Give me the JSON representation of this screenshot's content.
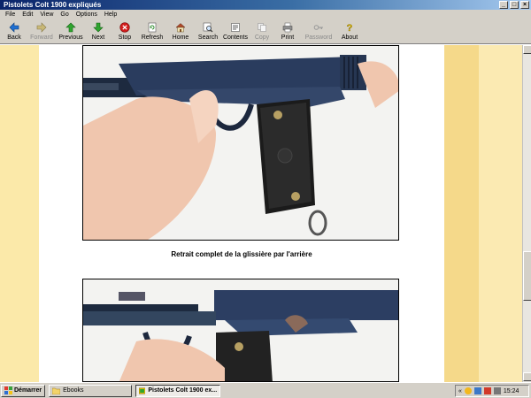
{
  "window": {
    "title": "Pistolets Colt 1900 expliqués",
    "controls": {
      "minimize": "_",
      "maximize": "□",
      "close": "×"
    }
  },
  "menu": {
    "items": [
      {
        "label": "File"
      },
      {
        "label": "Edit"
      },
      {
        "label": "View"
      },
      {
        "label": "Go"
      },
      {
        "label": "Options"
      },
      {
        "label": "Help"
      }
    ]
  },
  "toolbar": {
    "buttons": [
      {
        "label": "Back",
        "icon": "back-arrow-icon",
        "enabled": true
      },
      {
        "label": "Forward",
        "icon": "forward-arrow-icon",
        "enabled": false
      },
      {
        "label": "Previous",
        "icon": "up-arrow-icon",
        "enabled": true
      },
      {
        "label": "Next",
        "icon": "down-arrow-icon",
        "enabled": true
      },
      {
        "label": "Stop",
        "icon": "stop-icon",
        "enabled": true
      },
      {
        "label": "Refresh",
        "icon": "refresh-icon",
        "enabled": true
      },
      {
        "label": "Home",
        "icon": "home-icon",
        "enabled": true
      },
      {
        "label": "Search",
        "icon": "search-icon",
        "enabled": true
      },
      {
        "label": "Contents",
        "icon": "contents-icon",
        "enabled": true
      },
      {
        "label": "Copy",
        "icon": "copy-icon",
        "enabled": false
      },
      {
        "label": "Print",
        "icon": "print-icon",
        "enabled": true
      },
      {
        "label": "Password",
        "icon": "key-icon",
        "enabled": false
      },
      {
        "label": "About",
        "icon": "about-icon",
        "enabled": true
      }
    ]
  },
  "content": {
    "caption": "Retrait complet de la glissière par l'arrière",
    "colors": {
      "band_left": "#fbe9a9",
      "band_right_dark": "#f5d98a",
      "band_right_light": "#fbeab2",
      "page": "#ffffff"
    }
  },
  "taskbar": {
    "start_label": "Démarrer",
    "tasks": [
      {
        "label": "Ebooks"
      },
      {
        "label": "Pistolets Colt 1900 ex..."
      }
    ],
    "tray": {
      "lang": "«",
      "time": "15:24"
    }
  }
}
